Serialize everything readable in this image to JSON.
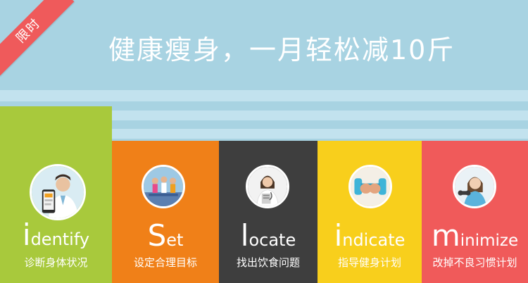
{
  "banner": {
    "ribbon_label": "限时",
    "headline": "健康瘦身，一月轻松减10斤",
    "colors": {
      "sky": "#a8d3e2",
      "stripe": "#c2e2ee",
      "ribbon": "#ef5a5b"
    }
  },
  "steps": [
    {
      "initial": "i",
      "rest": "dentify",
      "subtitle": "诊断身体状况",
      "color": "#a8c93c",
      "avatar_icon": "doctor-holding-phone-photo",
      "active": true
    },
    {
      "initial": "S",
      "rest": "et",
      "subtitle": "设定合理目标",
      "color": "#f08018",
      "avatar_icon": "fitness-class-photo",
      "active": false
    },
    {
      "initial": "l",
      "rest": "ocate",
      "subtitle": "找出饮食问题",
      "color": "#3e3e3e",
      "avatar_icon": "female-doctor-clipboard-photo",
      "active": false
    },
    {
      "initial": "i",
      "rest": "ndicate",
      "subtitle": "指导健身计划",
      "color": "#f8cf1c",
      "avatar_icon": "dumbbell-fists-photo",
      "active": false
    },
    {
      "initial": "m",
      "rest": "inimize",
      "subtitle": "改掉不良习惯计划",
      "color": "#f05a5a",
      "avatar_icon": "woman-dumbbell-photo",
      "active": false
    }
  ]
}
